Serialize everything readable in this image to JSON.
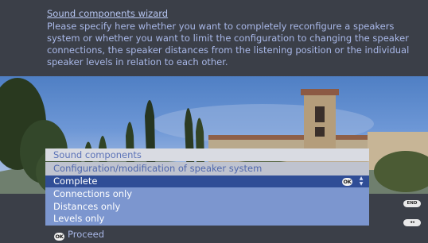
{
  "wizard": {
    "title": "Sound components wizard",
    "description": "Please specify here whether you want to completely reconfigure a speakers system or whether you want to limit the configuration to changing the speaker connections, the speaker distances from the listening position or the individual speaker levels in relation to each other."
  },
  "menu": {
    "header_main": "Sound components",
    "header_sub": "Configuration/modification of speaker system",
    "items": [
      {
        "label": "Complete",
        "selected": true
      },
      {
        "label": "Connections only",
        "selected": false
      },
      {
        "label": "Distances only",
        "selected": false
      },
      {
        "label": "Levels only",
        "selected": false
      }
    ],
    "ok_icon_text": "OK"
  },
  "footer": {
    "proceed_label": "Proceed",
    "ok_icon_text": "OK",
    "end_button": "END",
    "back_button": "◂◂"
  },
  "colors": {
    "panel_bg": "#3b3f48",
    "text_blue": "#a9b8e8",
    "selected_row": "#2f4d96",
    "list_bg": "#7c96cf"
  }
}
